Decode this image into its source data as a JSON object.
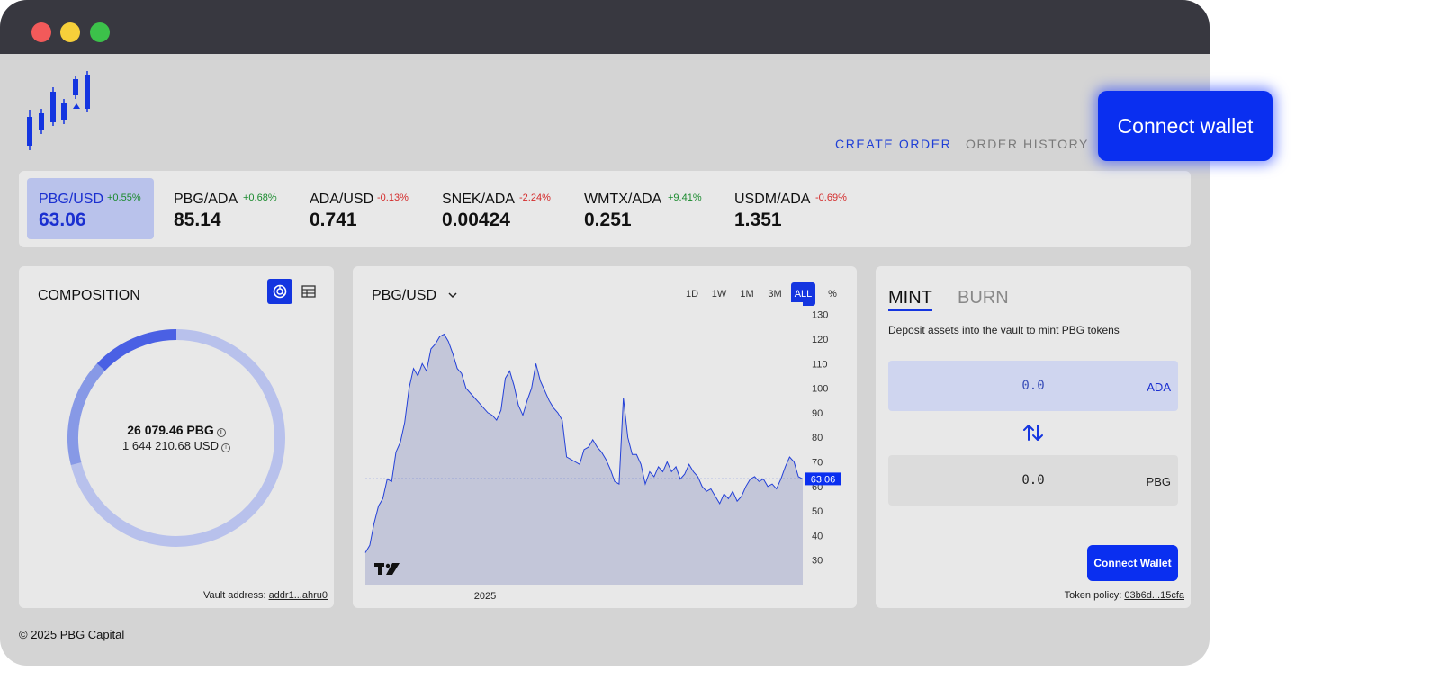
{
  "header": {
    "nav_create": "CREATE ORDER",
    "nav_history": "ORDER HISTORY",
    "connect_label": "Connect wallet"
  },
  "tickers": [
    {
      "pair": "PBG/USD",
      "change": "+0.55%",
      "price": "63.06",
      "trend": "up",
      "active": true
    },
    {
      "pair": "PBG/ADA",
      "change": "+0.68%",
      "price": "85.14",
      "trend": "up",
      "active": false
    },
    {
      "pair": "ADA/USD",
      "change": "-0.13%",
      "price": "0.741",
      "trend": "down",
      "active": false
    },
    {
      "pair": "SNEK/ADA",
      "change": "-2.24%",
      "price": "0.00424",
      "trend": "down",
      "active": false
    },
    {
      "pair": "WMTX/ADA",
      "change": "+9.41%",
      "price": "0.251",
      "trend": "up",
      "active": false
    },
    {
      "pair": "USDM/ADA",
      "change": "-0.69%",
      "price": "1.351",
      "trend": "down",
      "active": false
    }
  ],
  "composition": {
    "title": "COMPOSITION",
    "total_pbg": "26 079.46 PBG",
    "total_usd": "1 644 210.68 USD",
    "vault_label": "Vault address: ",
    "vault_address": "addr1...ahru0",
    "segments": [
      {
        "share": 0.71,
        "color": "#b8c1ec"
      },
      {
        "share": 0.16,
        "color": "#8799e6"
      },
      {
        "share": 0.13,
        "color": "#4a60e4"
      }
    ]
  },
  "chart": {
    "pair_label": "PBG/USD",
    "ranges": [
      "1D",
      "1W",
      "1M",
      "3M",
      "ALL",
      "%"
    ],
    "active_range": "ALL",
    "last_price_label": "63.06",
    "x_tick": "2025"
  },
  "chart_data": {
    "type": "area",
    "title": "PBG/USD",
    "xlabel": "",
    "ylabel": "",
    "ylim": [
      20,
      135
    ],
    "yticks": [
      30,
      40,
      50,
      60,
      70,
      80,
      90,
      100,
      110,
      120,
      130
    ],
    "last_value": 63.06,
    "series": [
      {
        "values": [
          33,
          36,
          45,
          52,
          55,
          63,
          62,
          74,
          78,
          86,
          100,
          108,
          105,
          110,
          107,
          116,
          118,
          121,
          122,
          119,
          114,
          108,
          106,
          100,
          98,
          96,
          94,
          92,
          90,
          89,
          87,
          91,
          104,
          107,
          101,
          93,
          89,
          95,
          100,
          110,
          103,
          99,
          95,
          92,
          90,
          87,
          72,
          71,
          70,
          69,
          75,
          76,
          79,
          76,
          74,
          71,
          67,
          62,
          61,
          96,
          80,
          73,
          73,
          69,
          61,
          66,
          64,
          68,
          66,
          70,
          66,
          68,
          63,
          65,
          69,
          66,
          64,
          60,
          58,
          59,
          56,
          53,
          57,
          55,
          58,
          54,
          56,
          60,
          63,
          64,
          62,
          63,
          60,
          61,
          59,
          63,
          68,
          72,
          70,
          64,
          63
        ]
      }
    ]
  },
  "mint": {
    "tab_mint": "MINT",
    "tab_burn": "BURN",
    "description": "Deposit assets into the vault to mint PBG tokens",
    "ada_value": "0.0",
    "ada_unit": "ADA",
    "pbg_value": "0.0",
    "pbg_unit": "PBG",
    "connect_label": "Connect Wallet",
    "policy_label": "Token policy: ",
    "policy_id": "03b6d...15cfa"
  },
  "footer": {
    "copyright": "© 2025 PBG Capital"
  },
  "colors": {
    "accent": "#0a2ff0",
    "positive": "#1a8a2e",
    "negative": "#d42b2b",
    "chart_fill": "#c3c6d9",
    "chart_line": "#2340d8"
  }
}
